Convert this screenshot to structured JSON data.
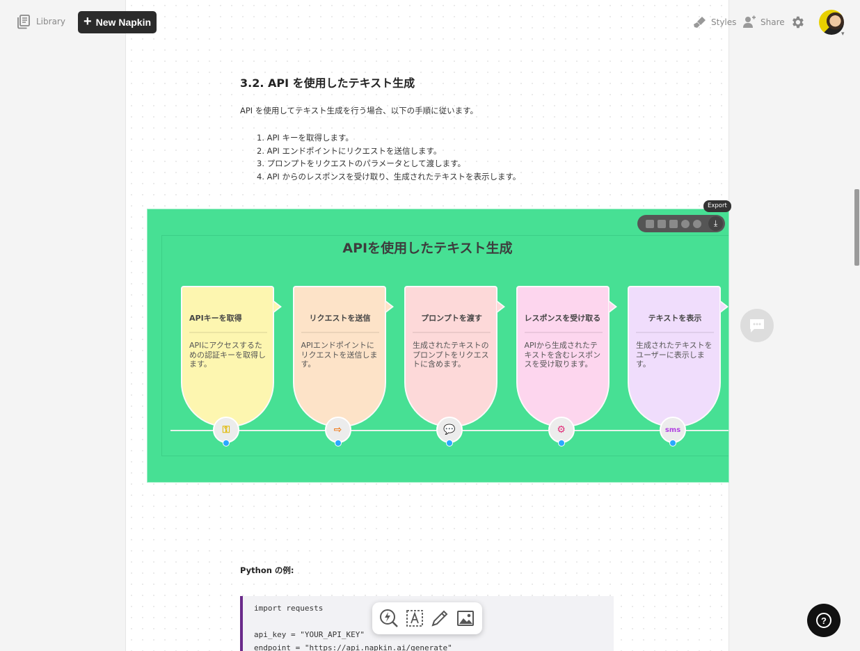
{
  "topbar": {
    "library_label": "Library",
    "new_napkin_label": "New Napkin",
    "styles_label": "Styles",
    "share_label": "Share"
  },
  "document": {
    "heading": "3.2. API を使用したテキスト生成",
    "intro": "API を使用してテキスト生成を行う場合、以下の手順に従います。",
    "steps": [
      "1. API キーを取得します。",
      "2. API エンドポイントにリクエストを送信します。",
      "3. プロンプトをリクエストのパラメータとして渡します。",
      "4. API からのレスポンスを受け取り、生成されたテキストを表示します。"
    ],
    "python_label": "Python の例:",
    "code_lines": [
      "import requests",
      "",
      "api_key = \"YOUR_API_KEY\"",
      "endpoint = \"https://api.napkin.ai/generate\""
    ]
  },
  "visual": {
    "background": "#47e094",
    "title": "APIを使用したテキスト生成",
    "export_tooltip": "Export",
    "cards": [
      {
        "title": "APIキーを取得",
        "desc": "APIにアクセスするための認証キーを取得します。",
        "color": "#fdf6b0",
        "accent": "#e0b800",
        "icon": "key-icon"
      },
      {
        "title": "リクエストを送信",
        "desc": "APIエンドポイントにリクエストを送信します。",
        "color": "#fde3c8",
        "accent": "#f07a1a",
        "icon": "arrow-right-icon"
      },
      {
        "title": "プロンプトを渡す",
        "desc": "生成されたテキストのプロンプトをリクエストに含めます。",
        "color": "#fdd9d9",
        "accent": "#e03030",
        "icon": "speech-icon"
      },
      {
        "title": "レスポンスを受け取る",
        "desc": "APIから生成されたテキストを含むレスポンスを受け取ります。",
        "color": "#fdd6ee",
        "accent": "#e0307a",
        "icon": "robot-icon"
      },
      {
        "title": "テキストを表示",
        "desc": "生成されたテキストをユーザーに表示します。",
        "color": "#f0ddfc",
        "accent": "#b040e0",
        "icon": "sms-icon"
      }
    ]
  }
}
